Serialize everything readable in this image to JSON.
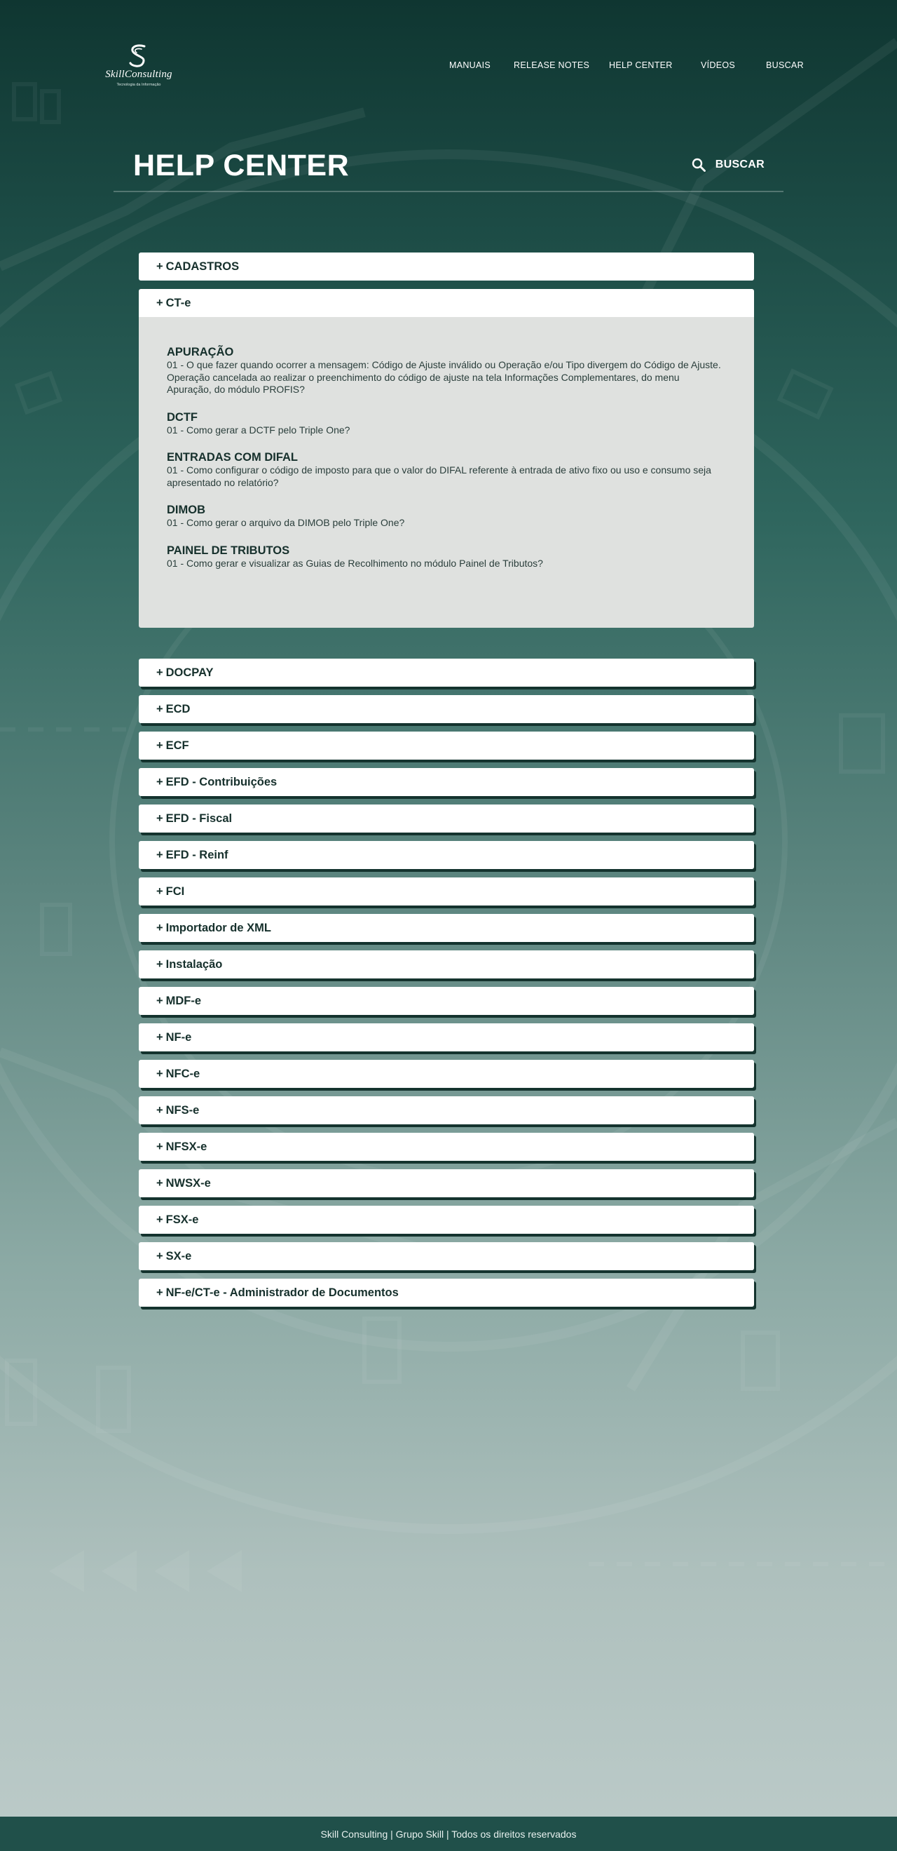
{
  "brand": {
    "logo_text": "SkillConsulting",
    "logo_tagline": "Tecnologia da Informação"
  },
  "nav": {
    "items": [
      {
        "label": "MANUAIS"
      },
      {
        "label": "RELEASE NOTES"
      },
      {
        "label": "HELP CENTER"
      },
      {
        "label": "VÍDEOS"
      },
      {
        "label": "BUSCAR"
      }
    ]
  },
  "page": {
    "title": "HELP CENTER",
    "search_label": "BUSCAR"
  },
  "accordion": {
    "first": {
      "label": "CADASTROS"
    },
    "open": {
      "label": "CT-e",
      "topics": [
        {
          "heading": "APURAÇÃO",
          "links": [
            "01 - O que fazer quando ocorrer a mensagem: Código de Ajuste inválido ou Operação e/ou Tipo divergem do Código de Ajuste. Operação cancelada ao realizar o preenchimento do código de ajuste na tela Informações Complementares, do menu Apuração, do módulo PROFIS?"
          ]
        },
        {
          "heading": "DCTF",
          "links": [
            "01 - Como gerar a DCTF pelo Triple One?"
          ]
        },
        {
          "heading": "ENTRADAS COM DIFAL",
          "links": [
            "01 - Como configurar o código de imposto para que o valor do DIFAL referente à entrada de ativo fixo ou uso e consumo seja apresentado no relatório?"
          ]
        },
        {
          "heading": "DIMOB",
          "links": [
            "01 - Como gerar o arquivo da DIMOB pelo Triple One?"
          ]
        },
        {
          "heading": "PAINEL DE TRIBUTOS",
          "links": [
            "01 - Como gerar e visualizar as Guias de Recolhimento no módulo Painel de Tributos?"
          ]
        }
      ]
    },
    "rest": [
      {
        "label": "DOCPAY"
      },
      {
        "label": "ECD"
      },
      {
        "label": "ECF"
      },
      {
        "label": "EFD - Contribuições"
      },
      {
        "label": "EFD - Fiscal"
      },
      {
        "label": "EFD - Reinf"
      },
      {
        "label": "FCI"
      },
      {
        "label": "Importador de XML"
      },
      {
        "label": "Instalação"
      },
      {
        "label": "MDF-e"
      },
      {
        "label": "NF-e"
      },
      {
        "label": "NFC-e"
      },
      {
        "label": "NFS-e"
      },
      {
        "label": "NFSX-e"
      },
      {
        "label": "NWSX-e"
      },
      {
        "label": "FSX-e"
      },
      {
        "label": "SX-e"
      },
      {
        "label": "NF-e/CT-e - Administrador de Documentos"
      }
    ],
    "plus_symbol": "+"
  },
  "footer": {
    "text": "Skill Consulting | Grupo Skill | Todos os direitos reservados"
  },
  "colors": {
    "header_dark": "#0f3631",
    "accordion_text": "#16302c",
    "accordion_shadow": "#14332e",
    "panel_bg": "#dfe1df",
    "footer_bg": "#20504a"
  }
}
